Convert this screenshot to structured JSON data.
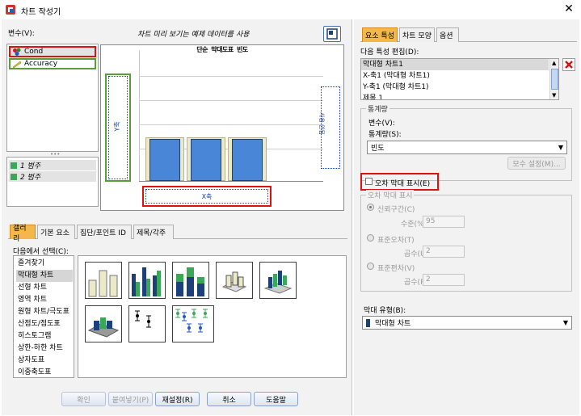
{
  "window": {
    "title": "차트 작성기",
    "close": "✕"
  },
  "left": {
    "variables_label": "변수(V):",
    "preview_note": "차트 미리 보기는 예제 데이터를 사용",
    "variables": [
      {
        "name": "Cond",
        "icon": "nominal-icon"
      },
      {
        "name": "Accuracy",
        "icon": "scale-icon"
      }
    ],
    "groups": [
      "1 범주",
      "2 범주"
    ],
    "chart": {
      "title": "단순 막대도표 빈도",
      "y_drop": "Y축",
      "x_drop": "X축",
      "right_drop": "사용 안됨"
    },
    "tabs": [
      "갤러리",
      "기본 요소",
      "집단/포인트 ID",
      "제목/각주"
    ],
    "select_from_label": "다음에서 선택(C):",
    "gallery_list": [
      "즐겨찾기",
      "막대형 차트",
      "선형 차트",
      "영역 차트",
      "원형 차트/극도표",
      "산점도/점도표",
      "히스토그램",
      "상한-하한 차트",
      "상자도표",
      "이중축도표"
    ],
    "selected_gallery_index": 1
  },
  "buttons": {
    "ok": "확인",
    "paste": "붙여넣기(P)",
    "reset": "재설정(R)",
    "cancel": "취소",
    "help": "도움말"
  },
  "right": {
    "tabs": [
      "요소 특성",
      "차트 모양",
      "옵션"
    ],
    "edit_props_label": "다음 특성 편집(D):",
    "props": [
      "막대형 차트1",
      "X-축1 (막대형 차트1)",
      "Y-축1 (막대형 차트1)",
      "제목 1"
    ],
    "stats_group": "통계량",
    "variable_label": "변수(V):",
    "statistic_label": "통계량(S):",
    "statistic_value": "빈도",
    "param_button": "모수 설정(M)...",
    "error_bars_label": "오차 막대 표시(E)",
    "error_bars_group": "오차 막대 표시",
    "ci_label": "신뢰구간(C)",
    "level_label": "수준(%)(L):",
    "level_value": "95",
    "se_label": "표준오차(T)",
    "multiplier_label": "곱수(U):",
    "multiplier_value": "2",
    "sd_label": "표준편차(V)",
    "multiplier2_label": "곱수(P):",
    "multiplier2_value": "2",
    "bar_style_label": "막대 유형(B):",
    "bar_style_value": "막대형 차트"
  }
}
